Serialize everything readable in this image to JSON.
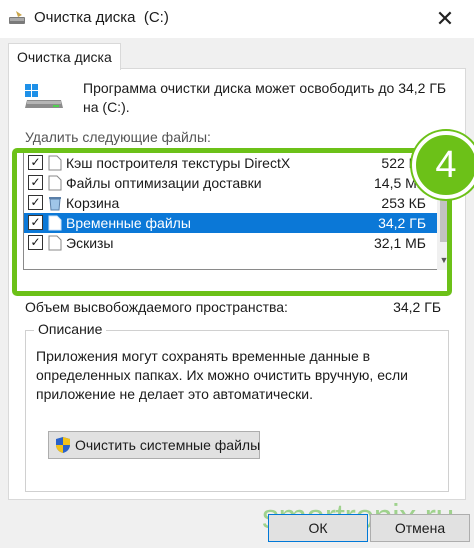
{
  "window": {
    "title": "Очистка диска  (C:)",
    "close_glyph": "✕"
  },
  "tab": {
    "label": "Очистка диска"
  },
  "intro": "Программа очистки диска может освободить до 34,2 ГБ на (C:).",
  "list_label": "Удалить следующие файлы:",
  "files": [
    {
      "name": "Кэш построителя текстуры DirectX",
      "size": "522 КБ",
      "checked": true,
      "icon": "file-icon",
      "selected": false
    },
    {
      "name": "Файлы оптимизации доставки",
      "size": "14,5 МБ",
      "checked": true,
      "icon": "file-icon",
      "selected": false
    },
    {
      "name": "Корзина",
      "size": "253 КБ",
      "checked": true,
      "icon": "recycle-bin-icon",
      "selected": false
    },
    {
      "name": "Временные файлы",
      "size": "34,2 ГБ",
      "checked": true,
      "icon": "file-icon",
      "selected": true
    },
    {
      "name": "Эскизы",
      "size": "32,1 МБ",
      "checked": true,
      "icon": "file-icon",
      "selected": false
    }
  ],
  "freed": {
    "label": "Объем высвобождаемого пространства:",
    "value": "34,2 ГБ"
  },
  "description": {
    "title": "Описание",
    "text": "Приложения могут сохранять временные данные в определенных папках. Их можно очистить вручную, если приложение не делает это автоматически."
  },
  "system_button": {
    "label": "Очистить системные файлы"
  },
  "buttons": {
    "ok": "ОК",
    "cancel": "Отмена"
  },
  "badge": "4",
  "watermark": "smartronix.ru",
  "colors": {
    "highlight": "#0b78d7",
    "annotation_green": "#6cc118",
    "watermark": "#9fd28d"
  }
}
